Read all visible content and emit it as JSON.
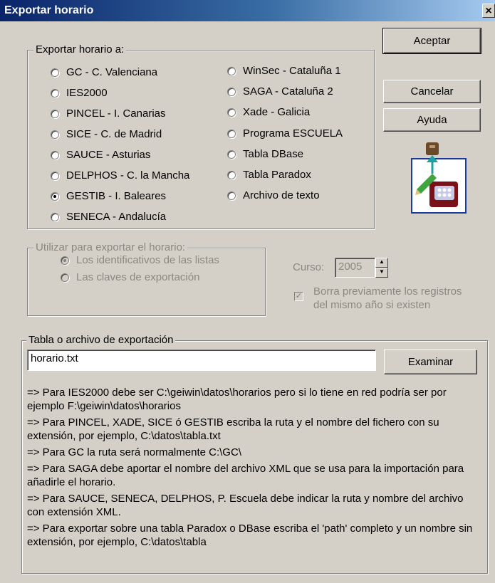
{
  "window": {
    "title": "Exportar horario",
    "close_label": "×"
  },
  "export_group": {
    "legend": "Exportar horario a:",
    "options_col1": [
      {
        "label": "GC - C. Valenciana",
        "checked": false
      },
      {
        "label": "IES2000",
        "checked": false
      },
      {
        "label": "PINCEL - I. Canarias",
        "checked": false
      },
      {
        "label": "SICE - C. de Madrid",
        "checked": false
      },
      {
        "label": "SAUCE - Asturias",
        "checked": false
      },
      {
        "label": "DELPHOS - C. la Mancha",
        "checked": false
      },
      {
        "label": "GESTIB - I. Baleares",
        "checked": true
      },
      {
        "label": "SENECA - Andalucía",
        "checked": false
      }
    ],
    "options_col2": [
      {
        "label": "WinSec - Cataluña 1",
        "checked": false
      },
      {
        "label": "SAGA - Cataluña 2",
        "checked": false
      },
      {
        "label": "Xade - Galicia",
        "checked": false
      },
      {
        "label": "Programa ESCUELA",
        "checked": false
      },
      {
        "label": "Tabla DBase",
        "checked": false
      },
      {
        "label": "Tabla Paradox",
        "checked": false
      },
      {
        "label": "Archivo de texto",
        "checked": false
      }
    ]
  },
  "buttons": {
    "accept": "Aceptar",
    "cancel": "Cancelar",
    "help": "Ayuda",
    "browse": "Examinar"
  },
  "use_group": {
    "legend": "Utilizar para exportar el horario:",
    "options": [
      {
        "label": "Los identificativos de las listas",
        "checked": true
      },
      {
        "label": "Las claves de exportación",
        "checked": false
      }
    ]
  },
  "course": {
    "label": "Curso:",
    "value": "2005",
    "up": "▲",
    "down": "▼"
  },
  "erase": {
    "checked": true,
    "mark": "✓",
    "line1": "Borra previamente los registros",
    "line2": "del mismo año si existen"
  },
  "file_group": {
    "legend": "Tabla o archivo de exportación",
    "path_value": "horario.txt",
    "notes": [
      "=> Para IES2000 debe ser C:\\geiwin\\datos\\horarios pero si lo tiene en red podría ser por ejemplo F:\\geiwin\\datos\\horarios",
      "=> Para PINCEL, XADE, SICE ó GESTIB escriba la ruta y el nombre del fichero con su extensión, por ejemplo, C:\\datos\\tabla.txt",
      "=> Para GC la ruta será normalmente C:\\GC\\",
      "=> Para SAGA debe aportar el nombre del archivo XML que se usa para la importación para añadirle el horario.",
      "=> Para SAUCE, SENECA, DELPHOS, P. Escuela debe indicar la ruta y nombre del archivo con extensión XML.",
      "=> Para exportar sobre una tabla Paradox o DBase escriba el 'path' completo y un nombre sin extensión, por ejemplo, C:\\datos\\tabla"
    ]
  },
  "colors": {
    "window_bg": "#d4d0c8",
    "title_start": "#0a246a",
    "title_end": "#a6caf0"
  },
  "icons": {
    "export_icon": "export-schedule-icon"
  }
}
